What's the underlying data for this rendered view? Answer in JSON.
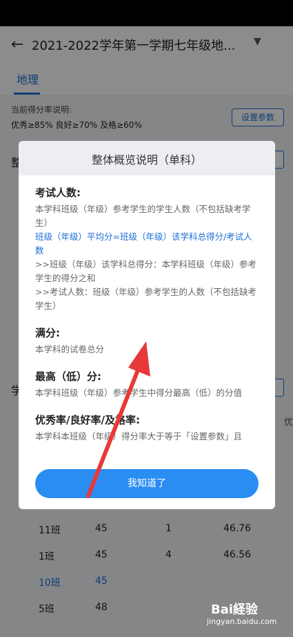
{
  "header": {
    "back_icon": "arrow-left-icon",
    "title": "2021-2022学年第一学期七年级地...",
    "dropdown_icon": "caret-down-icon"
  },
  "tabs": [
    {
      "label": "地理"
    }
  ],
  "info": {
    "label": "当前得分率说明:",
    "thresholds": "优秀≥85% 良好≥70% 及格≥60%",
    "param_button": "设置参数"
  },
  "background_fragments": {
    "left1": "整",
    "left2": "学",
    "right": "优"
  },
  "table_rows": [
    {
      "class": "11班",
      "count": "45",
      "rank": "1",
      "avg": "46.76",
      "highlight": false
    },
    {
      "class": "1班",
      "count": "45",
      "rank": "4",
      "avg": "46.56",
      "highlight": false
    },
    {
      "class": "10班",
      "count": "45",
      "rank": "",
      "avg": "",
      "highlight": true
    },
    {
      "class": "5班",
      "count": "48",
      "rank": "",
      "avg": "",
      "highlight": false
    }
  ],
  "modal": {
    "title": "整体概览说明（单科）",
    "sections": [
      {
        "heading": "考试人数:",
        "lines": [
          {
            "text": "本学科班级（年级）参考学生的学生人数（不包括缺考学生）",
            "blue": false
          },
          {
            "text": "班级（年级）平均分=班级（年级）该学科总得分/考试人数",
            "blue": true
          },
          {
            "text": ">>班级（年级）该学科总得分：本学科班级（年级）参考学生的得分之和",
            "blue": false
          },
          {
            "text": ">>考试人数：班级（年级）参考学生的人数（不包括缺考学生）",
            "blue": false
          }
        ]
      },
      {
        "heading": "满分:",
        "lines": [
          {
            "text": "本学科的试卷总分",
            "blue": false
          }
        ]
      },
      {
        "heading": "最高（低）分:",
        "lines": [
          {
            "text": "本学科班级（年级）参考学生中得分最高（低）的分值",
            "blue": false
          }
        ]
      },
      {
        "heading": "优秀率/良好率/及格率:",
        "lines": [
          {
            "text": "本学科本班级（年级）得分率大于等于「设置参数」且",
            "blue": false
          }
        ]
      }
    ],
    "ok_button": "我知道了"
  },
  "watermark": {
    "brand": "Bai経验",
    "url": "jingyan.baidu.com"
  },
  "colors": {
    "accent": "#1a6fd6",
    "button": "#2a8df2",
    "arrow": "#e8393a"
  }
}
